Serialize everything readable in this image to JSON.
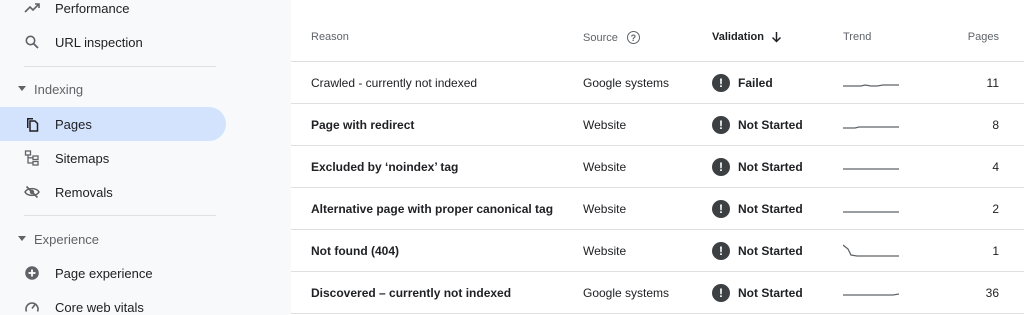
{
  "sidebar": {
    "items_top": [
      {
        "label": "Performance",
        "icon": "trending-up-icon"
      },
      {
        "label": "URL inspection",
        "icon": "search-icon"
      }
    ],
    "sections": [
      {
        "title": "Indexing",
        "items": [
          {
            "label": "Pages",
            "icon": "pages-icon",
            "active": true
          },
          {
            "label": "Sitemaps",
            "icon": "sitemap-icon"
          },
          {
            "label": "Removals",
            "icon": "visibility-off-icon"
          }
        ]
      },
      {
        "title": "Experience",
        "items": [
          {
            "label": "Page experience",
            "icon": "add-circle-icon"
          },
          {
            "label": "Core web vitals",
            "icon": "speed-gauge-icon"
          }
        ]
      }
    ]
  },
  "table": {
    "headers": {
      "reason": "Reason",
      "source": "Source",
      "validation": "Validation",
      "trend": "Trend",
      "pages": "Pages"
    },
    "sort_column": "validation",
    "sort_direction": "down",
    "rows": [
      {
        "reason": "Crawled - currently not indexed",
        "source": "Google systems",
        "validation": "Failed",
        "pages": "11",
        "bold": false
      },
      {
        "reason": "Page with redirect",
        "source": "Website",
        "validation": "Not Started",
        "pages": "8",
        "bold": true
      },
      {
        "reason": "Excluded by ‘noindex’ tag",
        "source": "Website",
        "validation": "Not Started",
        "pages": "4",
        "bold": true
      },
      {
        "reason": "Alternative page with proper canonical tag",
        "source": "Website",
        "validation": "Not Started",
        "pages": "2",
        "bold": true
      },
      {
        "reason": "Not found (404)",
        "source": "Website",
        "validation": "Not Started",
        "pages": "1",
        "bold": true
      },
      {
        "reason": "Discovered – currently not indexed",
        "source": "Google systems",
        "validation": "Not Started",
        "pages": "36",
        "bold": true
      }
    ]
  },
  "colors": {
    "active_nav_bg": "#d3e3fd",
    "status_icon": "#3c4043",
    "sparkline": "#5f6368"
  }
}
